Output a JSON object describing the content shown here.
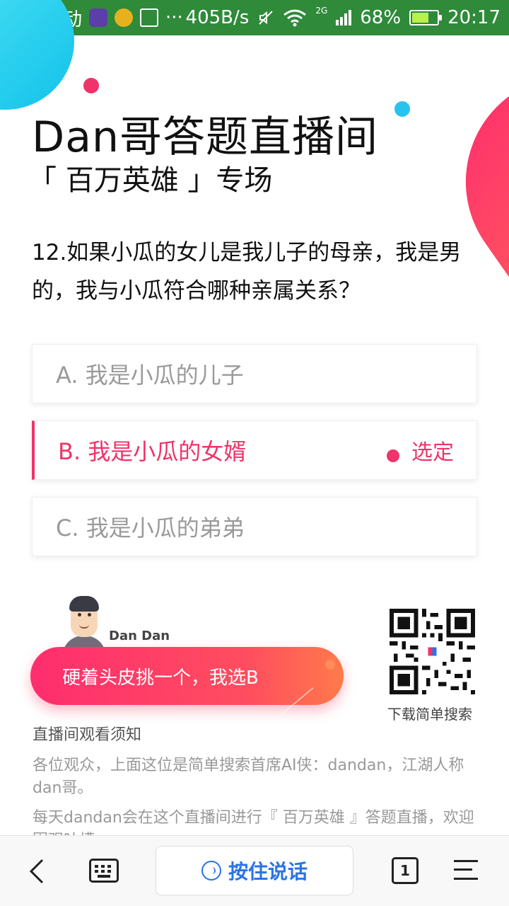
{
  "statusbar": {
    "carrier": "中国移动",
    "net_speed": "405B/s",
    "net_type": "2G",
    "battery": "68%",
    "battery_level": 0.68,
    "time": "20:17"
  },
  "header": {
    "title": "Dan哥答题直播间",
    "subtitle": "「 百万英雄 」专场"
  },
  "question": {
    "text": "12.如果小瓜的女儿是我儿子的母亲，我是男的，我与小瓜符合哪种亲属关系？"
  },
  "options": [
    {
      "label": "A. 我是小瓜的儿子",
      "selected": false
    },
    {
      "label": "B. 我是小瓜的女婿",
      "selected": true,
      "selected_label": "选定"
    },
    {
      "label": "C. 我是小瓜的弟弟",
      "selected": false
    }
  ],
  "host": {
    "name": "Dan Dan",
    "pick_button": "硬着头皮挑一个，我选B"
  },
  "qr": {
    "label": "下载简单搜索"
  },
  "notice": {
    "title": "直播间观看须知",
    "p1": "各位观众，上面这位是简单搜索首席AI侠：dandan，江湖人称dan哥。",
    "p2": "每天dandan会在这个直播间进行『 百万英雄 』答题直播，欢迎围观吐槽。"
  },
  "bottombar": {
    "voice_label": "按住说话",
    "tabs_count": "1"
  },
  "colors": {
    "status_green": "#2f8a3a",
    "accent_pink": "#f0336a",
    "voice_blue": "#2a73e8"
  }
}
